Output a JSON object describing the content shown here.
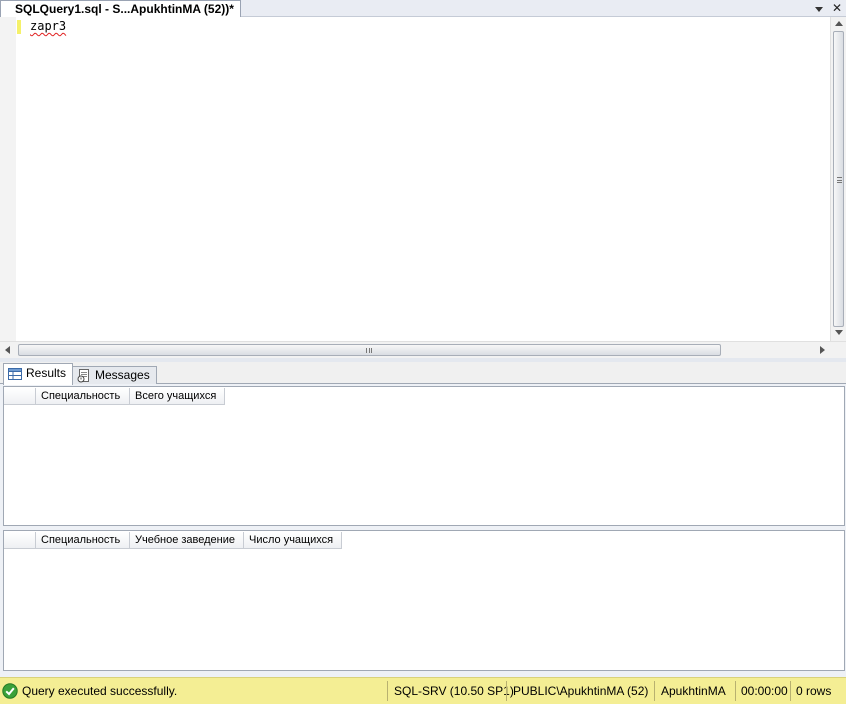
{
  "document_tab": {
    "title": "SQLQuery1.sql - S...ApukhtinMA (52))*",
    "close_glyph": "✕"
  },
  "editor": {
    "lines": [
      "zapr3"
    ]
  },
  "results_tabs": [
    {
      "label": "Results",
      "icon": "grid-icon",
      "active": true
    },
    {
      "label": "Messages",
      "icon": "messages-icon",
      "active": false
    }
  ],
  "result_grids": [
    {
      "columns": [
        "Специальность",
        "Всего учащихся"
      ],
      "rows": []
    },
    {
      "columns": [
        "Специальность",
        "Учебное заведение",
        "Число учащихся"
      ],
      "rows": []
    }
  ],
  "status_bar": {
    "message": "Query executed successfully.",
    "server": "SQL-SRV (10.50 SP1)",
    "login": "PUBLIC\\ApukhtinMA (52)",
    "database": "ApukhtinMA",
    "elapsed": "00:00:00",
    "rows": "0 rows",
    "background_color": "#f4ee94",
    "success_icon_color": "#3aa13a"
  }
}
